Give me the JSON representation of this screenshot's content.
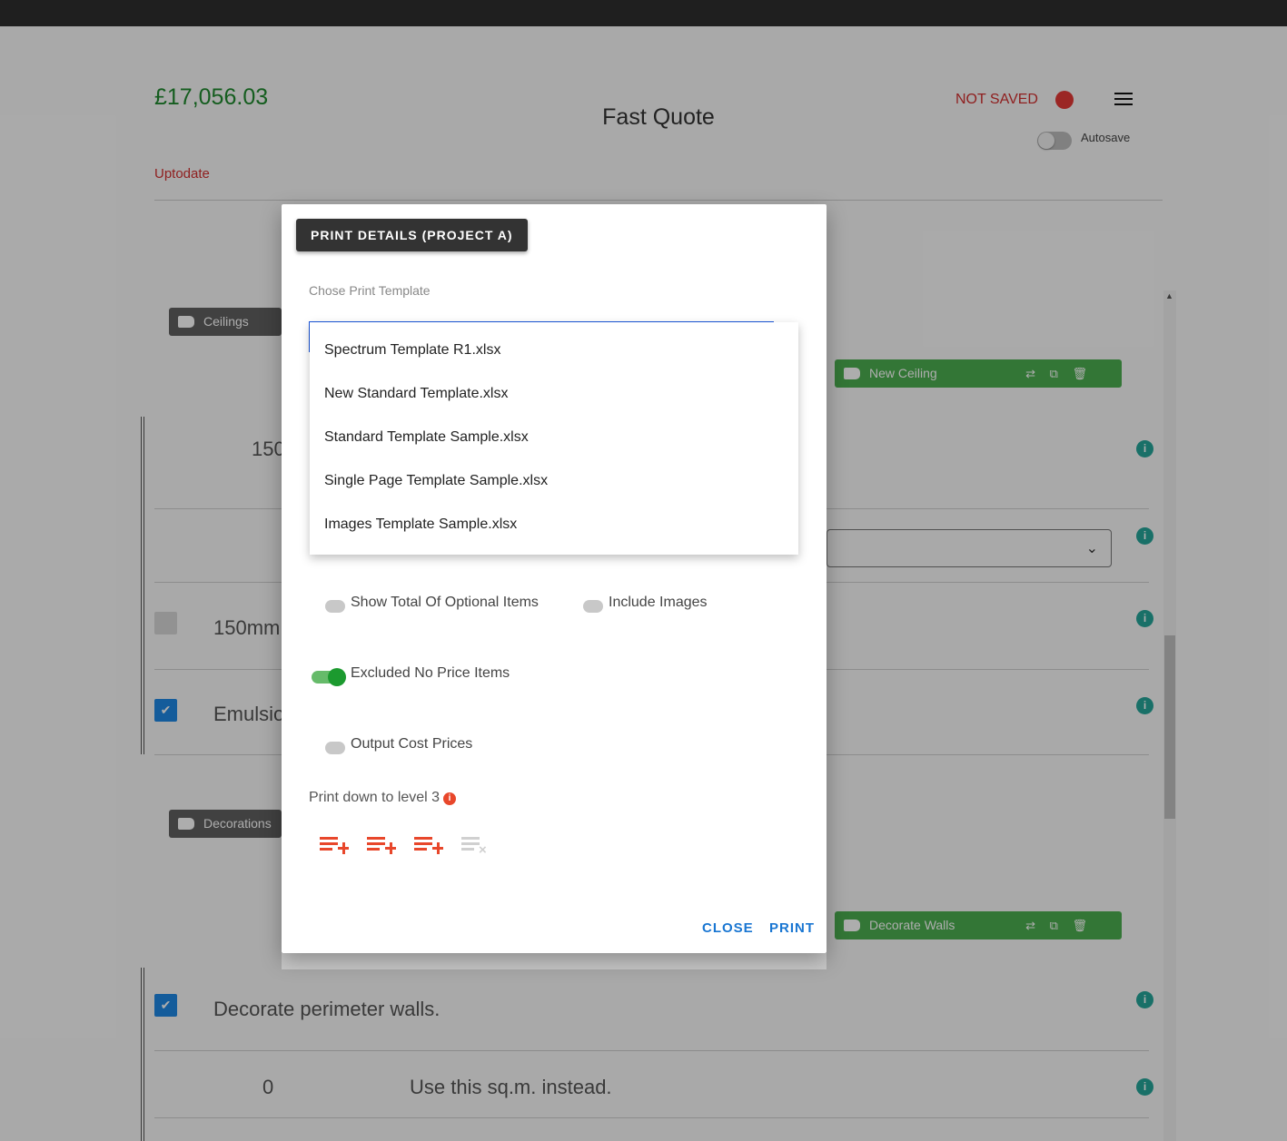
{
  "header": {
    "price": "£17,056.03",
    "title": "Fast Quote",
    "save_status": "NOT SAVED",
    "autosave_label": "Autosave",
    "sync_status": "Uptodate"
  },
  "background": {
    "ceilings_chip": "Ceilings",
    "new_ceiling_chip": "New Ceiling",
    "decorations_chip": "Decorations",
    "decorate_walls_chip": "Decorate Walls",
    "row1_value": "150",
    "row3_text": "150mm",
    "row4_text": "Emulsio",
    "row5_text": "Decorate perimeter walls.",
    "row6_value": "0",
    "row6_text": "Use this sq.m. instead.",
    "chip_actions": "⇄ ⧉ 🗑"
  },
  "dialog": {
    "header": "PRINT DETAILS (PROJECT A)",
    "template_label": "Chose Print Template",
    "template_options": [
      "Spectrum Template R1.xlsx",
      "New Standard Template.xlsx",
      "Standard Template Sample.xlsx",
      "Single Page Template Sample.xlsx",
      "Images Template Sample.xlsx"
    ],
    "show_total_optional": "Show Total Of Optional Items",
    "show_total_optional_on": false,
    "include_images": "Include Images",
    "include_images_on": false,
    "excluded_no_price": "Excluded No Price Items",
    "excluded_no_price_on": true,
    "output_cost_prices": "Output Cost Prices",
    "output_cost_prices_on": false,
    "print_level_label": "Print down to level 3",
    "close_label": "CLOSE",
    "print_label": "PRINT"
  },
  "colors": {
    "price_green": "#1f8a2e",
    "status_red": "#d32f2f",
    "accent_blue": "#1976d2",
    "level_icon_orange": "#e8472b",
    "toggle_on_green": "#1c9a2f"
  }
}
